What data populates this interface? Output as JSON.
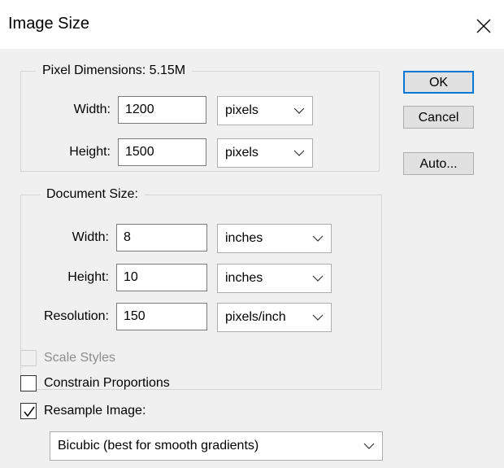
{
  "dialog": {
    "title": "Image Size"
  },
  "pixel_dimensions": {
    "legend": "Pixel Dimensions:  5.15M",
    "width_label": "Width:",
    "width_value": "1200",
    "width_unit": "pixels",
    "height_label": "Height:",
    "height_value": "1500",
    "height_unit": "pixels"
  },
  "document_size": {
    "legend": "Document Size:",
    "width_label": "Width:",
    "width_value": "8",
    "width_unit": "inches",
    "height_label": "Height:",
    "height_value": "10",
    "height_unit": "inches",
    "resolution_label": "Resolution:",
    "resolution_value": "150",
    "resolution_unit": "pixels/inch"
  },
  "options": {
    "scale_styles": {
      "label": "Scale Styles",
      "checked": false,
      "enabled": false
    },
    "constrain_proportions": {
      "label": "Constrain Proportions",
      "checked": false,
      "enabled": true
    },
    "resample_image": {
      "label": "Resample Image:",
      "checked": true,
      "enabled": true
    },
    "resample_method": "Bicubic (best for smooth gradients)"
  },
  "buttons": {
    "ok": "OK",
    "cancel": "Cancel",
    "auto": "Auto..."
  }
}
